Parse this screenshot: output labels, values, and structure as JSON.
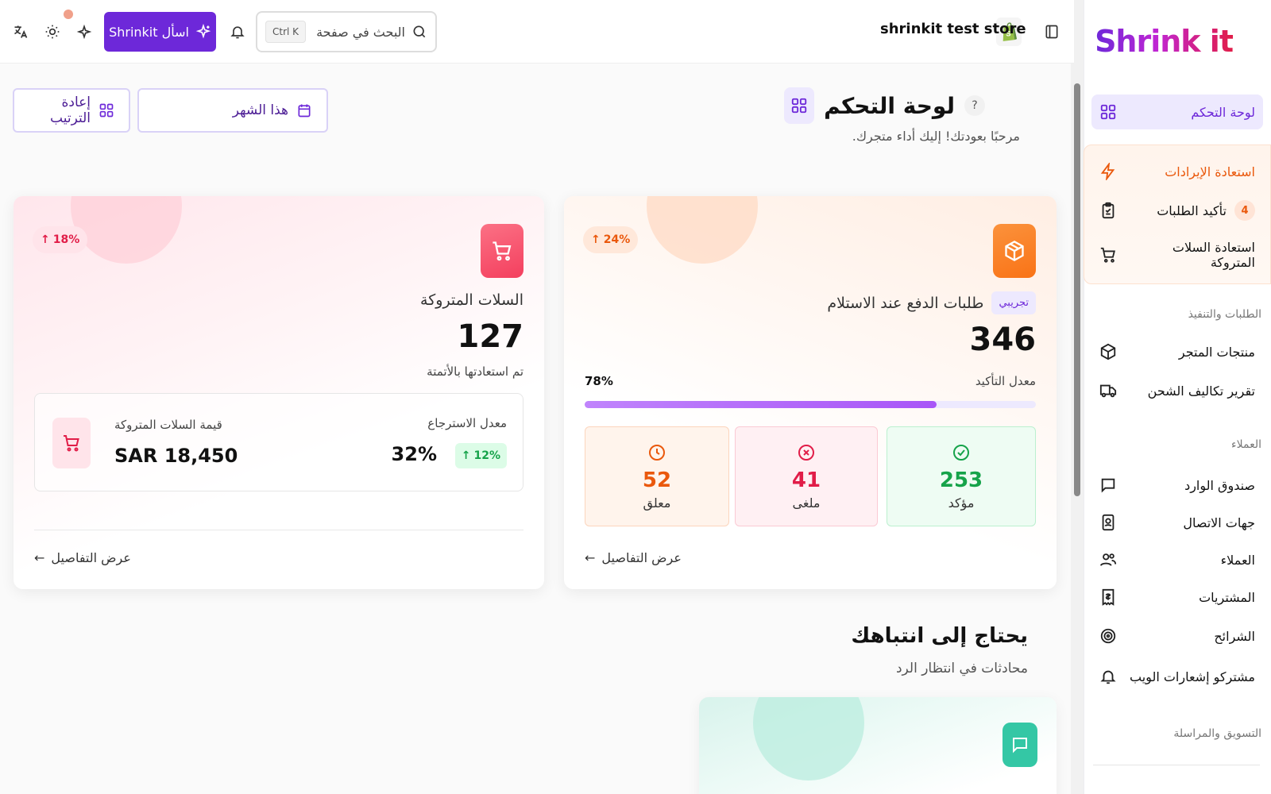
{
  "brand": {
    "logo_text": "Shrink it"
  },
  "topbar": {
    "store_name": "shrinkit test store",
    "search_placeholder": "البحث في صفحة",
    "search_shortcut": "Ctrl K",
    "ask_label": "اسأل Shrinkit"
  },
  "sidebar": {
    "items": [
      {
        "label": "لوحة التحكم",
        "icon": "grid-icon",
        "active": true
      },
      {
        "label": "استعادة الإيرادات",
        "icon": "bolt-icon"
      },
      {
        "label": "تأكيد الطلبات",
        "icon": "clipboard-check-icon",
        "badge": "4"
      },
      {
        "label": "استعادة السلات المتروكة",
        "icon": "cart-icon"
      }
    ],
    "sections": [
      {
        "label": "الطلبات والتنفيذ",
        "items": [
          {
            "label": "منتجات المتجر",
            "icon": "box-icon"
          },
          {
            "label": "تقرير تكاليف الشحن",
            "icon": "truck-icon"
          }
        ]
      },
      {
        "label": "العملاء",
        "items": [
          {
            "label": "صندوق الوارد",
            "icon": "chat-icon"
          },
          {
            "label": "جهات الاتصال",
            "icon": "contact-book-icon"
          },
          {
            "label": "العملاء",
            "icon": "users-icon"
          },
          {
            "label": "المشتريات",
            "icon": "receipt-icon"
          },
          {
            "label": "الشرائح",
            "icon": "target-icon"
          },
          {
            "label": "مشتركو إشعارات الويب",
            "icon": "bell-icon"
          }
        ]
      },
      {
        "label": "التسويق والمراسلة",
        "items": []
      }
    ]
  },
  "page": {
    "title": "لوحة التحكم",
    "help": "?",
    "subtitle": "مرحبًا بعودتك! إليك أداء متجرك.",
    "period_button": "هذا الشهر",
    "reorder_button": "إعادة الترتيب"
  },
  "cod_card": {
    "title": "طلبات الدفع عند الاستلام",
    "tag": "تجريبي",
    "change": "24%",
    "value": "346",
    "rate_label": "معدل التأكيد",
    "rate_value": "78%",
    "rate_fraction": 0.78,
    "stats": [
      {
        "value": "253",
        "label": "مؤكد",
        "color": "#16a34a"
      },
      {
        "value": "41",
        "label": "ملغى",
        "color": "#e11d48"
      },
      {
        "value": "52",
        "label": "معلق",
        "color": "#ea580c"
      }
    ],
    "details_label": "عرض التفاصيل"
  },
  "abandoned_card": {
    "title": "السلات المتروكة",
    "change": "18%",
    "value": "127",
    "sub_label": "تم استعادتها بالأتمتة",
    "recovery_rate_label": "معدل الاسترجاع",
    "recovery_rate_value": "32%",
    "recovery_change": "12%",
    "abandoned_value_label": "قيمة السلات المتروكة",
    "abandoned_value": "SAR 18,450",
    "details_label": "عرض التفاصيل"
  },
  "attention": {
    "title": "يحتاج إلى انتباهك",
    "subtitle": "محادثات في انتظار الرد"
  },
  "colors": {
    "accent": "#6d28d9",
    "orange": "#f97316",
    "pink": "#f43f5e",
    "teal": "#34c7a5"
  }
}
